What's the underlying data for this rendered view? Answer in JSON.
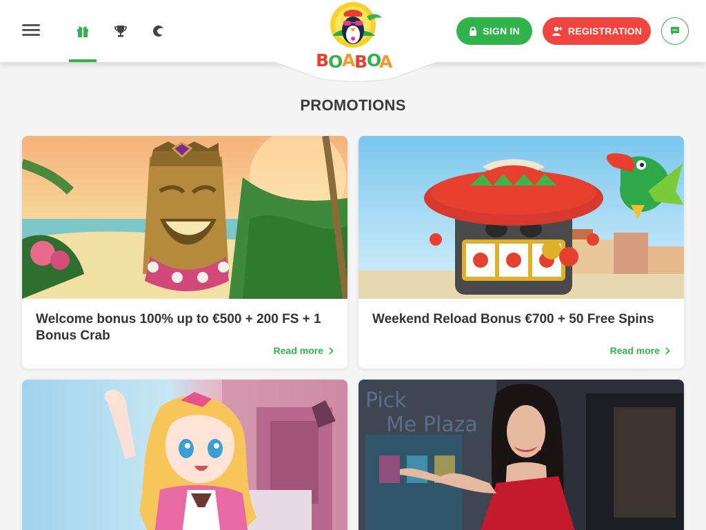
{
  "header": {
    "signin_label": "SIGN IN",
    "register_label": "REGISTRATION",
    "logo_text": "BOABOA",
    "nav": [
      {
        "name": "promotions",
        "icon": "gift-icon",
        "active": true
      },
      {
        "name": "tournaments",
        "icon": "trophy-icon",
        "active": false
      },
      {
        "name": "casino",
        "icon": "moon-icon",
        "active": false
      }
    ],
    "colors": {
      "accent": "#2fb34a",
      "register": "#f0463f"
    }
  },
  "page": {
    "title": "PROMOTIONS"
  },
  "promotions": [
    {
      "title": "Welcome bonus 100% up to €500 + 200 FS + 1 Bonus Crab",
      "link_label": "Read more",
      "image": "tiki-totem-beach"
    },
    {
      "title": "Weekend Reload Bonus €700 + 50 Free Spins",
      "link_label": "Read more",
      "image": "sombrero-slot-toucan"
    },
    {
      "title": "",
      "link_label": "",
      "image": "anime-maid-girl"
    },
    {
      "title": "",
      "link_label": "",
      "image": "live-dealer-woman"
    }
  ]
}
